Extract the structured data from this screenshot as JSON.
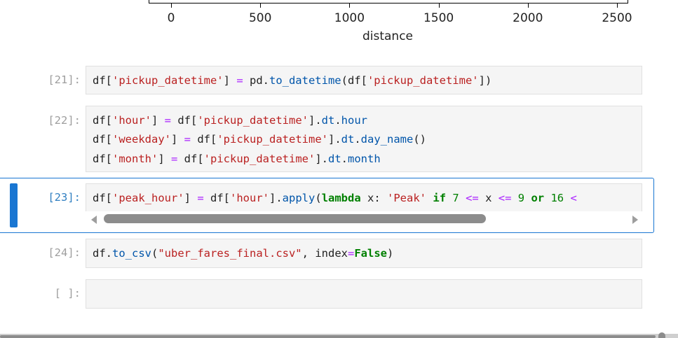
{
  "chart_data": {
    "type": "axis-fragment",
    "xlabel": "distance",
    "x_ticks": [
      "0",
      "500",
      "1000",
      "1500",
      "2000",
      "2500"
    ]
  },
  "cells": [
    {
      "prompt": "[21]:",
      "code": [
        "df['pickup_datetime'] = pd.to_datetime(df['pickup_datetime'])"
      ]
    },
    {
      "prompt": "[22]:",
      "code": [
        "df['hour'] = df['pickup_datetime'].dt.hour",
        "df['weekday'] = df['pickup_datetime'].dt.day_name()",
        "df['month'] = df['pickup_datetime'].dt.month"
      ]
    },
    {
      "prompt": "[23]:",
      "code": [
        "df['peak_hour'] = df['hour'].apply(lambda x: 'Peak' if 7 <= x <= 9 or 16 <"
      ]
    },
    {
      "prompt": "[24]:",
      "code": [
        "df.to_csv(\"uber_fares_final.csv\", index=False)"
      ]
    },
    {
      "prompt": "[ ]:",
      "code": [
        ""
      ]
    }
  ],
  "colors": {
    "active_accent": "#1976d2",
    "string": "#ba2121",
    "keyword": "#008000",
    "operator": "#aa22ff",
    "attribute": "#0055aa"
  }
}
